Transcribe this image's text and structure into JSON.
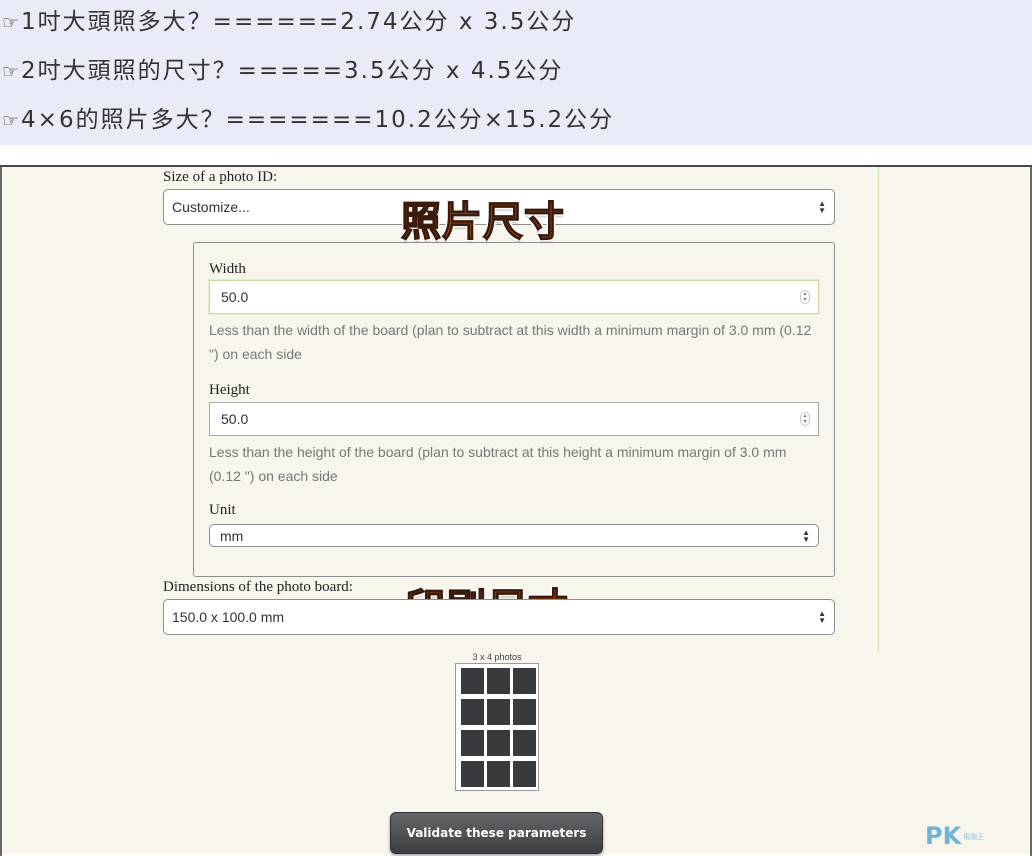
{
  "info": {
    "hand_icon": "☞",
    "lines": [
      "1吋大頭照多大？======2.74公分 x 3.5公分",
      "2吋大頭照的尺寸？=====3.5公分 x 4.5公分",
      "4×6的照片多大？=======10.2公分×15.2公分"
    ],
    "background": "#e9ebf8"
  },
  "form": {
    "photo_id_label": "Size of a photo ID:",
    "photo_id_value": "Customize...",
    "annotation_photo_size": "照片尺寸",
    "width": {
      "label": "Width",
      "value": "50.0",
      "help": "Less than the width of the board (plan to subtract at this width a minimum margin of 3.0 mm (0.12 \") on each side"
    },
    "height": {
      "label": "Height",
      "value": "50.0",
      "help": "Less than the height of the board (plan to subtract at this height a minimum margin of 3.0 mm (0.12 \") on each side"
    },
    "unit": {
      "label": "Unit",
      "value": "mm"
    },
    "board_label": "Dimensions of the photo board:",
    "board_value": "150.0 x 100.0 mm",
    "annotation_print_size": "印刷尺寸",
    "preview_caption": "3 x 4 photos",
    "preview_grid": {
      "columns": 3,
      "rows": 4
    },
    "validate_label": "Validate these parameters"
  },
  "watermark": {
    "main": "PK",
    "sub": "電腦王"
  },
  "colors": {
    "annotation": "#f36b21",
    "panel_bg": "#f7f5ec",
    "button": "#4b4d50",
    "cell": "#383a3d"
  }
}
